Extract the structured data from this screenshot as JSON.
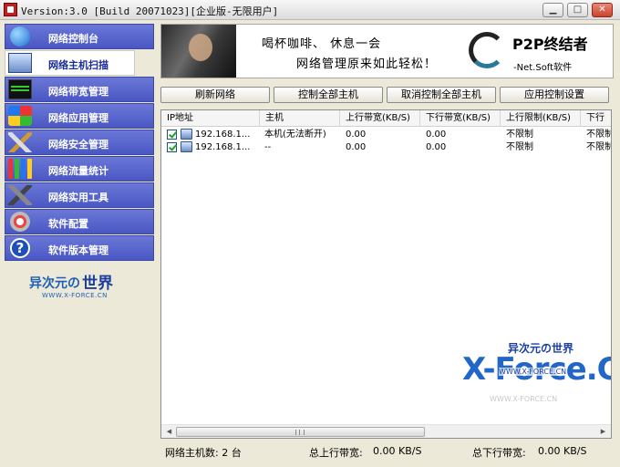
{
  "window": {
    "title": "Version:3.0 [Build 20071023][企业版-无限用户]",
    "minimize_icon": "minimize-icon",
    "maximize_icon": "maximize-icon",
    "close_icon": "close-icon"
  },
  "sidebar": {
    "items": [
      {
        "label": "网络控制台",
        "icon": "globe-icon"
      },
      {
        "label": "网络主机扫描",
        "icon": "monitor-icon"
      },
      {
        "label": "网络带宽管理",
        "icon": "bandwidth-chart-icon"
      },
      {
        "label": "网络应用管理",
        "icon": "apps-icon"
      },
      {
        "label": "网络安全管理",
        "icon": "tools-icon"
      },
      {
        "label": "网络流量统计",
        "icon": "stats-icon"
      },
      {
        "label": "网络实用工具",
        "icon": "utility-tools-icon"
      },
      {
        "label": "软件配置",
        "icon": "config-icon"
      },
      {
        "label": "软件版本管理",
        "icon": "help-icon"
      }
    ],
    "active_index": 1,
    "brand": {
      "part1": "异次元の",
      "part2": "世界",
      "url": "WWW.X-FORCE.CN"
    }
  },
  "banner": {
    "slogan_line1": "喝杯咖啡、 休息一会",
    "slogan_line2": "网络管理原来如此轻松！",
    "product_name": "P2P终结者",
    "product_sub": "-Net.Soft软件"
  },
  "toolbar": {
    "refresh": "刷新网络",
    "control_all": "控制全部主机",
    "cancel_all": "取消控制全部主机",
    "apply": "应用控制设置"
  },
  "table": {
    "columns": [
      "IP地址",
      "主机",
      "上行带宽(KB/S)",
      "下行带宽(KB/S)",
      "上行限制(KB/S)",
      "下行"
    ],
    "rows": [
      {
        "checked": true,
        "ip": "192.168.1...",
        "host": "本机(无法断开)",
        "up": "0.00",
        "down": "0.00",
        "up_limit": "不限制",
        "down_limit": "不限制"
      },
      {
        "checked": true,
        "ip": "192.168.1...",
        "host": "--",
        "up": "0.00",
        "down": "0.00",
        "up_limit": "不限制",
        "down_limit": "不限制"
      }
    ],
    "watermark": {
      "cn": "异次元の世界",
      "big": "X-Force.CN",
      "url": "WWW.X-FORCE.CN",
      "ghost": "WWW.X-FORCE.CN"
    }
  },
  "status": {
    "host_count": "网络主机数: 2 台",
    "total_up_label": "总上行带宽:",
    "total_up_value": "0.00 KB/S",
    "total_down_label": "总下行带宽:",
    "total_down_value": "0.00 KB/S"
  }
}
